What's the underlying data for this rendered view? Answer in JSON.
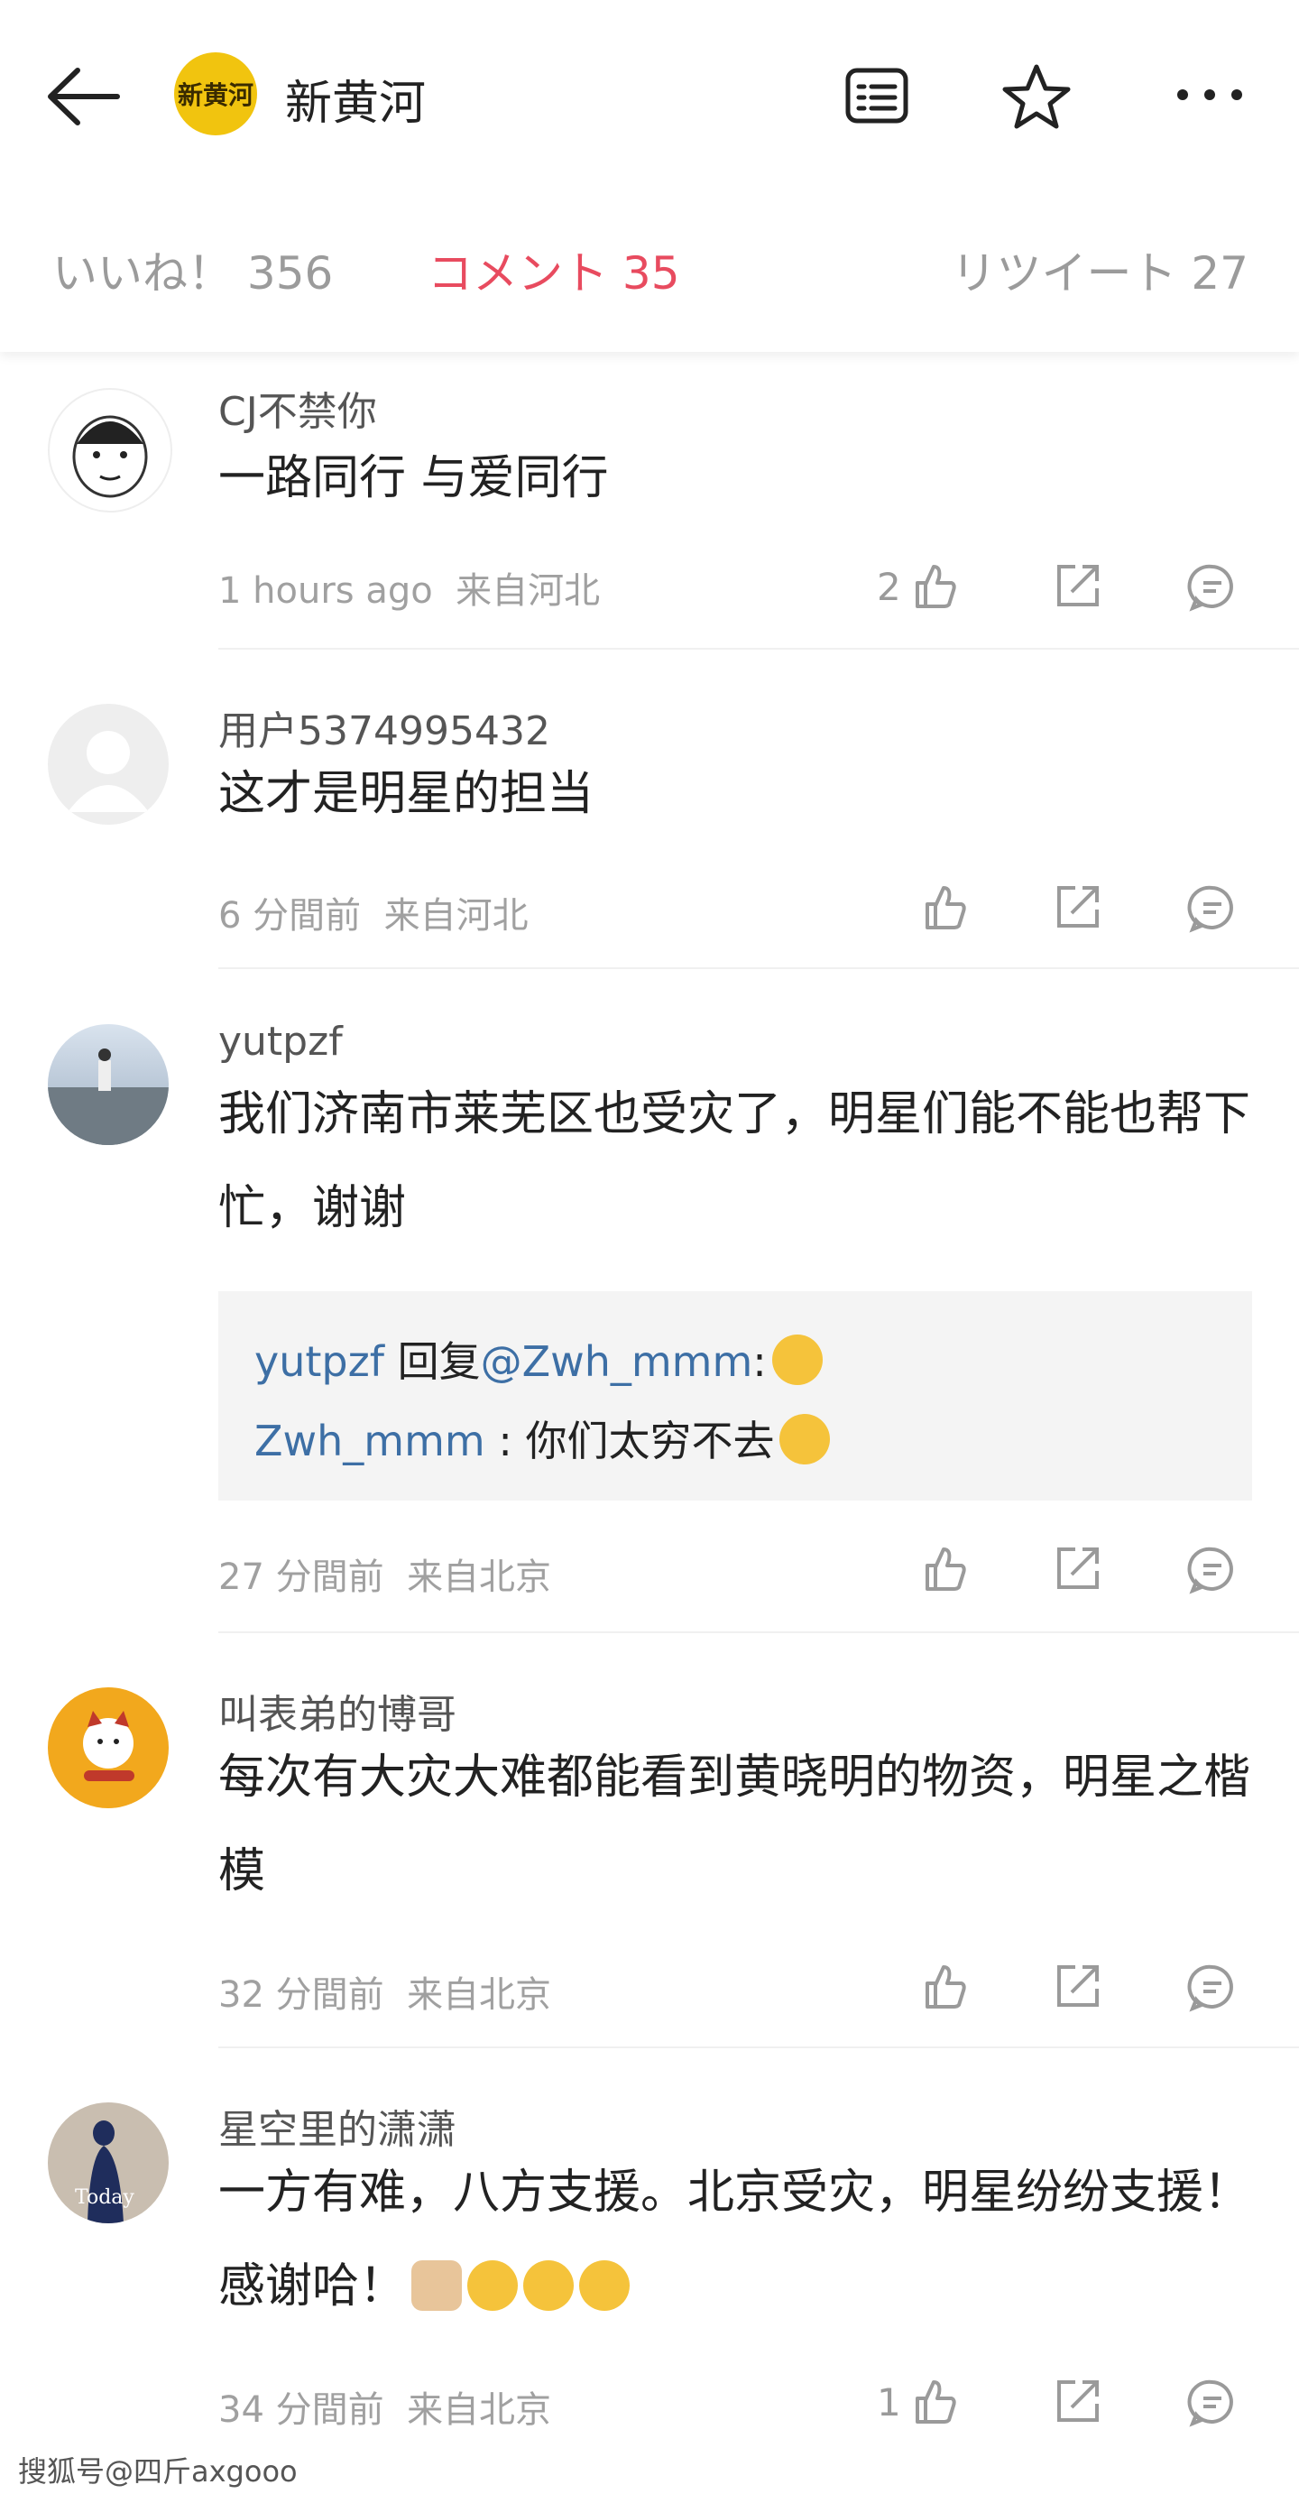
{
  "header": {
    "account_name": "新黄河",
    "logo_text": "新黄河",
    "icons": [
      "back-arrow-icon",
      "reader-mode-icon",
      "star-icon",
      "more-icon"
    ]
  },
  "tabs": [
    {
      "label": "いいね！ 356"
    },
    {
      "label": "コメント 35"
    },
    {
      "label": "リツイート 27"
    }
  ],
  "comments": [
    {
      "name": "CJ不禁你",
      "text": "一路同行 与爱同行",
      "time": "1 hours ago",
      "location": "来自河北",
      "likes": "2"
    },
    {
      "name": "用户5374995432",
      "text": "这才是明星的担当",
      "time": "6 分間前",
      "location": "来自河北",
      "likes": ""
    },
    {
      "name": "yutpzf",
      "text": "我们济南市莱芜区也受灾了，明星们能不能也帮下忙，谢谢",
      "time": "27 分間前",
      "location": "来自北京",
      "likes": "",
      "reply": {
        "line1_user": "yutpzf",
        "line1_mid": " 回复",
        "line1_target": "@Zwh_mmm",
        "line1_tail": ":",
        "line2_user": "Zwh_mmm",
        "line2_text": " : 你们太穷不去"
      }
    },
    {
      "name": "叫表弟的博哥",
      "text": "每次有大灾大难都能看到黄晓明的物资，明星之楷模",
      "time": "32 分間前",
      "location": "来自北京",
      "likes": ""
    },
    {
      "name": "星空里的潇潇",
      "text": "一方有难，八方支援。北京受灾，明星纷纷支援！感谢哈！",
      "time": "34 分間前",
      "location": "来自北京",
      "likes": "1"
    }
  ],
  "avatar4_watermark": "Today",
  "footer_watermark": "搜狐号@四斤axgooo",
  "colors": {
    "accent": "#e84b5f",
    "link": "#3d6fa5",
    "muted": "#a0a0a0"
  }
}
